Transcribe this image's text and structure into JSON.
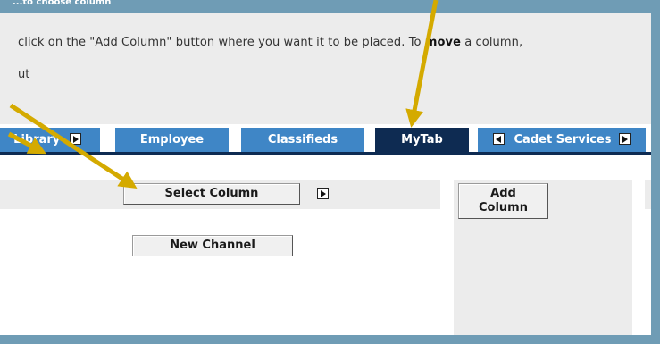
{
  "header": {
    "cut_off_text": "...to choose column"
  },
  "instructions": {
    "line1_before": "click on the \"Add Column\" button where you want it to be placed. To ",
    "line1_bold": "move",
    "line1_after": " a column,",
    "line2": "ut"
  },
  "tabs": [
    {
      "label": "Library",
      "active": false
    },
    {
      "label": "Employee",
      "active": false
    },
    {
      "label": "Classifieds",
      "active": false
    },
    {
      "label": "MyTab",
      "active": true
    },
    {
      "label": "Cadet Services",
      "active": false
    }
  ],
  "buttons": {
    "select_column": "Select Column",
    "new_channel": "New Channel",
    "add_column_line1": "Add",
    "add_column_line2": "Column"
  },
  "colors": {
    "frame": "#6f9cb5",
    "tab": "#3f86c6",
    "tab_active": "#0e2b52",
    "annotation_arrow": "#d4aa00"
  },
  "annotations": {
    "arrow_icons": [
      "annotation-arrow-icon",
      "annotation-arrow-icon",
      "annotation-arrow-icon"
    ]
  }
}
